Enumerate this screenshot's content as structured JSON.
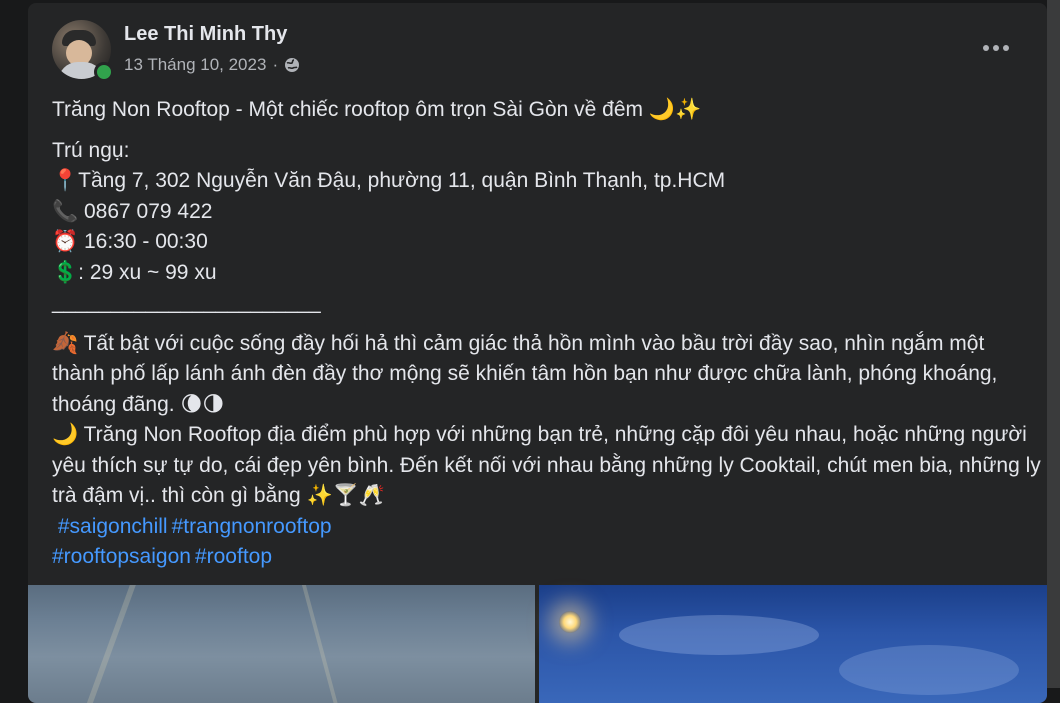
{
  "post": {
    "author": "Lee Thi Minh Thy",
    "date": "13 Tháng 10, 2023",
    "date_separator": "·",
    "privacy_icon": "globe-icon",
    "more_icon": "more-options-icon",
    "title_line": "Trăng Non Rooftop - Một chiếc rooftop ôm trọn Sài Gòn về đêm 🌙✨",
    "info_heading": "Trú ngụ:",
    "address": "📍Tầng 7, 302 Nguyễn Văn Đậu, phường 11, quận Bình Thạnh, tp.HCM",
    "phone": "📞 0867 079 422",
    "hours": "⏰ 16:30 - 00:30",
    "price": "💲: 29 xu ~ 99 xu",
    "divider": "_______________________",
    "paragraph1": "🍂 Tất bật với cuộc sống đầy hối hả thì cảm giác thả hồn mình vào bầu trời đầy sao, nhìn ngắm một thành phố lấp lánh ánh đèn đầy thơ mộng sẽ khiến tâm hồn bạn như được chữa lành, phóng khoáng, thoáng đãng. 🌘🌗",
    "paragraph2": "🌙 Trăng Non Rooftop địa điểm phù hợp với những bạn trẻ, những cặp đôi yêu nhau, hoặc những người yêu thích sự tự do, cái đẹp yên bình. Đến kết nối với nhau bằng những ly Cooktail, chút men bia, những ly trà đậm vị.. thì còn gì bằng ✨🍸🥂",
    "hashtags_line1": [
      "#saigonchill",
      "#trangnonrooftop"
    ],
    "hashtags_line2": [
      "#rooftopsaigon",
      "#rooftop"
    ]
  },
  "colors": {
    "background": "#18191a",
    "card": "#242526",
    "text_primary": "#e4e6eb",
    "text_secondary": "#b0b3b8",
    "link": "#4599ff",
    "online": "#31a24c"
  }
}
